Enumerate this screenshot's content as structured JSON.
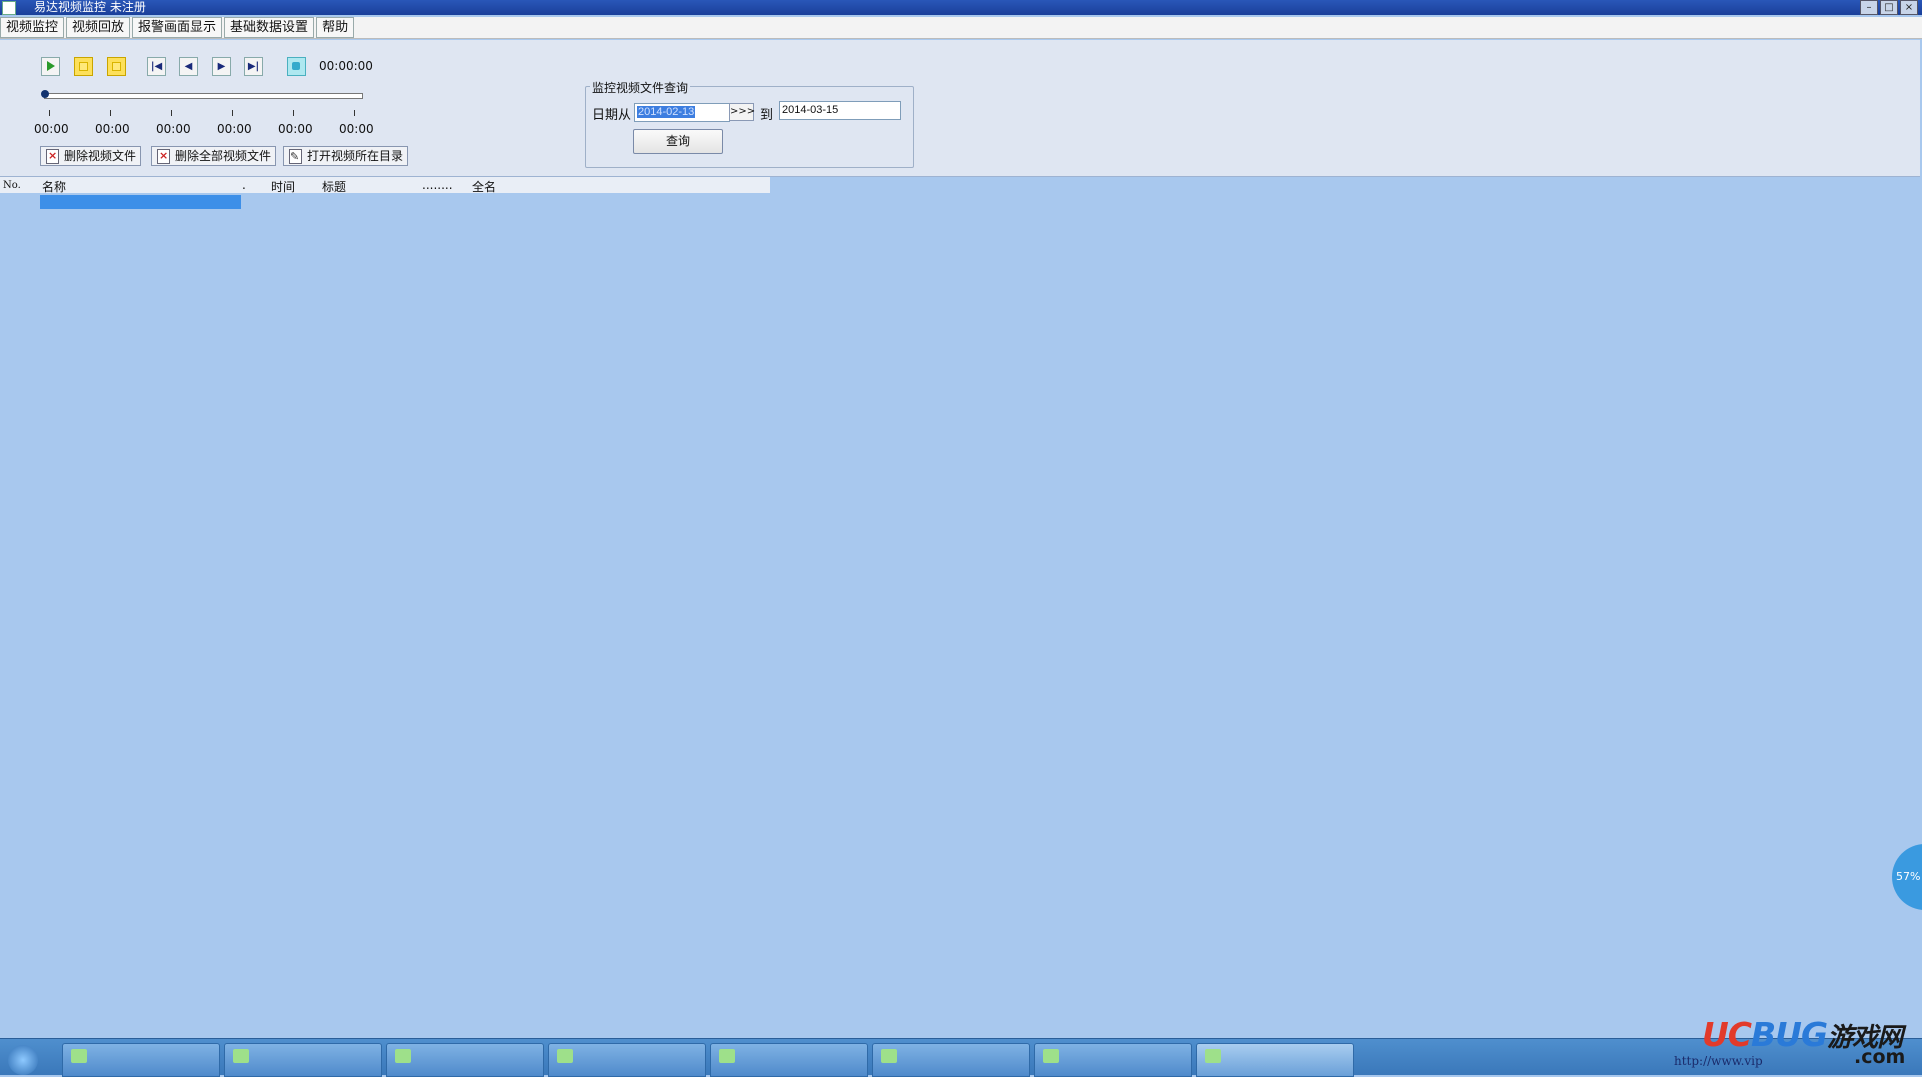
{
  "window": {
    "title": "易达视频监控 未注册"
  },
  "menu": [
    "视频监控",
    "视频回放",
    "报警画面显示",
    "基础数据设置",
    "帮助"
  ],
  "player": {
    "time": "00:00:00",
    "tick_labels": [
      "00:00",
      "00:00",
      "00:00",
      "00:00",
      "00:00",
      "00:00"
    ],
    "progress": 0
  },
  "actions": {
    "delete_file": "删除视频文件",
    "delete_all": "删除全部视频文件",
    "open_dir": "打开视频所在目录"
  },
  "query": {
    "group_title": "监控视频文件查询",
    "from_label": "日期从",
    "from_value": "2014-02-13",
    "arrow": ">>>",
    "to_label": "到",
    "to_value": "2014-03-15",
    "button": "查询"
  },
  "list": {
    "columns": [
      "No.",
      "名称",
      ".",
      "时间",
      "标题",
      "........",
      "全名"
    ]
  },
  "taskbar": {
    "url": "http://www.vip",
    "items_count": 8
  },
  "watermark": {
    "uc": "UC",
    "bug": "BUG",
    "cn": "游戏网",
    "com": ".com"
  },
  "float_ball": {
    "label": "57%"
  }
}
